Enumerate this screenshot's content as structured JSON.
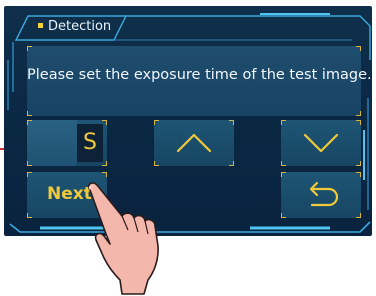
{
  "dialog": {
    "tab_title": "Detection",
    "message": "Please set the exposure time of the test image."
  },
  "keys": {
    "unit_label": "S",
    "next_label": "Next"
  },
  "icons": {
    "up": "chevron-up-icon",
    "down": "chevron-down-icon",
    "back": "return-arrow-icon"
  },
  "colors": {
    "background": "#0a2742",
    "panel": "#1f4d6e",
    "accent": "#f0c93a",
    "frame": "#3ca9de",
    "text": "#f2f7fc"
  }
}
